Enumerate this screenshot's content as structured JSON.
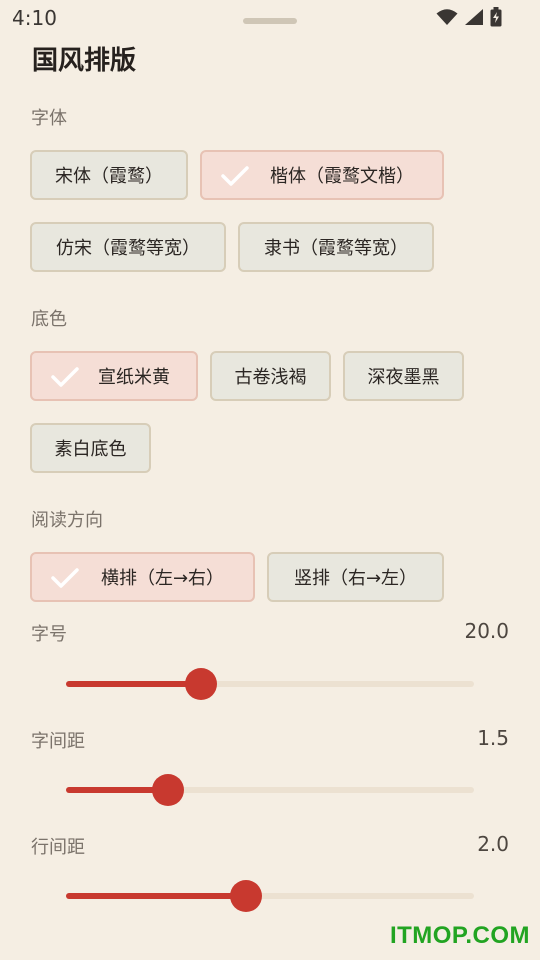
{
  "status_bar": {
    "time": "4:10"
  },
  "page": {
    "title": "国风排版"
  },
  "font_section": {
    "label": "字体",
    "options": [
      {
        "label": "宋体（霞鹜）",
        "selected": false
      },
      {
        "label": "楷体（霞鹜文楷）",
        "selected": true
      },
      {
        "label": "仿宋（霞鹜等宽）",
        "selected": false
      },
      {
        "label": "隶书（霞鹜等宽）",
        "selected": false
      }
    ]
  },
  "bg_section": {
    "label": "底色",
    "options": [
      {
        "label": "宣纸米黄",
        "selected": true
      },
      {
        "label": "古卷浅褐",
        "selected": false
      },
      {
        "label": "深夜墨黑",
        "selected": false
      },
      {
        "label": "素白底色",
        "selected": false
      }
    ]
  },
  "direction_section": {
    "label": "阅读方向",
    "options": [
      {
        "label": "横排（左→右）",
        "selected": true
      },
      {
        "label": "竖排（右→左）",
        "selected": false
      }
    ]
  },
  "sliders": {
    "font_size": {
      "label": "字号",
      "value": "20.0",
      "fraction": 0.33
    },
    "letter_spacing": {
      "label": "字间距",
      "value": "1.5",
      "fraction": 0.25
    },
    "line_spacing": {
      "label": "行间距",
      "value": "2.0",
      "fraction": 0.44
    }
  },
  "colors": {
    "accent": "#c8392f",
    "background": "#f5eee3",
    "chip": "#e8e7de",
    "chip_selected": "#f5ded6"
  },
  "watermark": "ITMOP.COM"
}
